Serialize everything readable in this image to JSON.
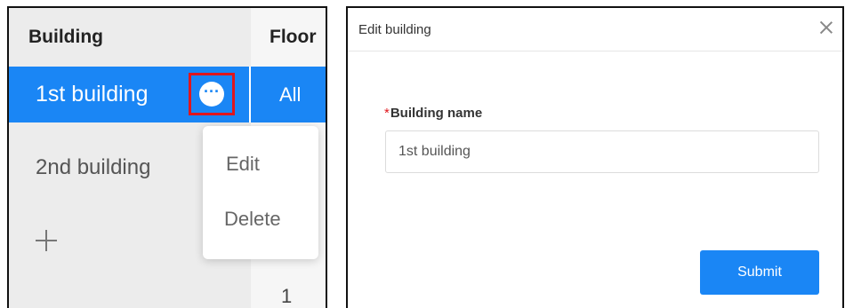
{
  "building_panel": {
    "header": "Building",
    "floor_header": "Floor",
    "selected_building": "1st building",
    "floor_selected_value": "All",
    "more_icon": "more-horizontal-icon",
    "other_building": "2nd building",
    "add_icon": "plus-icon",
    "floor_value": "1",
    "selected_bg_color": "#1a86f5",
    "highlight_color": "#e0161d"
  },
  "context_menu": {
    "edit_label": "Edit",
    "delete_label": "Delete"
  },
  "dialog": {
    "title": "Edit building",
    "close_icon": "close-icon",
    "field_required_mark": "*",
    "field_label": "Building name",
    "field_value": "1st building",
    "submit_label": "Submit"
  }
}
